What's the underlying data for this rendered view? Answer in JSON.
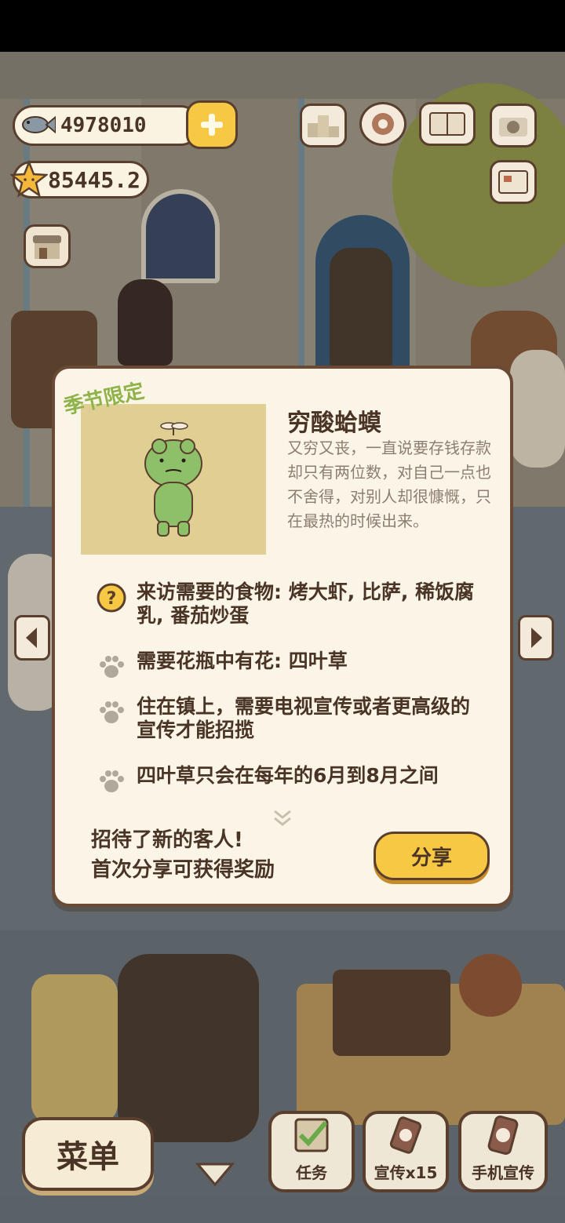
{
  "hud": {
    "fish_count": "4978010",
    "star_count": "85445.2"
  },
  "guest": {
    "season_tag": "季节限定",
    "name": "穷酸蛤蟆",
    "description": "又穷又丧，一直说要存钱存款却只有两位数，对自己一点也不舍得，对别人却很慷慨，只在最热的时候出来。"
  },
  "requirements": [
    {
      "icon": "question-icon",
      "text": "来访需要的食物: 烤大虾, 比萨, 稀饭腐乳, 番茄炒蛋"
    },
    {
      "icon": "paw-icon",
      "text": "需要花瓶中有花: 四叶草"
    },
    {
      "icon": "paw-icon",
      "text": "住在镇上，需要电视宣传或者更高级的宣传才能招揽"
    },
    {
      "icon": "paw-icon",
      "text": "四叶草只会在每年的6月到8月之间"
    }
  ],
  "footer": {
    "line1": "招待了新的客人!",
    "line2": "首次分享可获得奖励",
    "share_label": "分享"
  },
  "bottom_bar": {
    "menu_label": "菜单",
    "tasks_label": "任务",
    "promo_label": "宣传x15",
    "phone_promo_label": "手机宣传"
  },
  "colors": {
    "accent_yellow": "#f7c843",
    "outline_brown": "#5a3f2e",
    "season_green": "#8fb34a",
    "panel_cream": "#fbf5e8"
  }
}
